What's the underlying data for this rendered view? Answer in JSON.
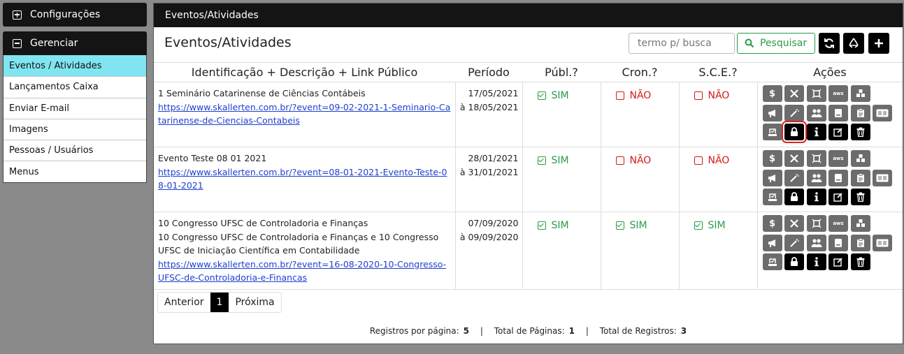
{
  "sidebar": {
    "configuracoes": "Configurações",
    "gerenciar": "Gerenciar",
    "items": [
      {
        "label": "Eventos / Atividades"
      },
      {
        "label": "Lançamentos Caixa"
      },
      {
        "label": "Enviar E-mail"
      },
      {
        "label": "Imagens"
      },
      {
        "label": "Pessoas / Usuários"
      },
      {
        "label": "Menus"
      }
    ]
  },
  "header": {
    "title": "Eventos/Atividades"
  },
  "page": {
    "title": "Eventos/Atividades"
  },
  "search": {
    "placeholder": "termo p/ busca",
    "button": "Pesquisar"
  },
  "toolbar_icons": [
    "refresh-icon",
    "recycle-icon",
    "plus-icon"
  ],
  "columns": [
    "Identificação + Descrição + Link Público",
    "Período",
    "Públ.?",
    "Cron.?",
    "S.C.E.?",
    "Ações"
  ],
  "rows": [
    {
      "lines": [
        "1 Seminário Catarinense de Ciências Contábeis"
      ],
      "link": "https://www.skallerten.com.br/?event=09-02-2021-1-Seminario-Catarinense-de-Ciencias-Contabeis",
      "start": "17/05/2021",
      "end": "à 18/05/2021",
      "publ": "SIM",
      "cron": "NÃO",
      "sce": "NÃO"
    },
    {
      "lines": [
        "Evento Teste 08 01 2021"
      ],
      "link": "https://www.skallerten.com.br/?event=08-01-2021-Evento-Teste-08-01-2021",
      "start": "28/01/2021",
      "end": "à 31/01/2021",
      "publ": "SIM",
      "cron": "NÃO",
      "sce": "NÃO"
    },
    {
      "lines": [
        "10 Congresso UFSC de Controladoria e Finanças",
        "10 Congresso UFSC de Controladoria e Finanças e 10 Congresso UFSC de Iniciação Científica em Contabilidade"
      ],
      "link": "https://www.skallerten.com.br/?event=16-08-2020-10-Congresso-UFSC-de-Controladoria-e-Financas",
      "start": "07/09/2020",
      "end": "à 09/09/2020",
      "publ": "SIM",
      "cron": "SIM",
      "sce": "SIM"
    }
  ],
  "actions_icons": [
    "dollar-icon",
    "tools-icon",
    "frame-icon",
    "aws-icon",
    "boxes-icon",
    "megaphone-icon",
    "magic-wand-icon",
    "users-icon",
    "book-icon",
    "clipboard-icon",
    "id-card-icon",
    "certificate-icon",
    "lock-icon",
    "info-icon",
    "edit-icon",
    "trash-icon"
  ],
  "aws_text": "aws",
  "pagination": {
    "prev": "Anterior",
    "current": "1",
    "next": "Próxima"
  },
  "stats": {
    "per_page_label": "Registros por página:",
    "per_page": "5",
    "pages_label": "Total de Páginas:",
    "pages": "1",
    "total_label": "Total de Registros:",
    "total": "3",
    "sep": "|"
  },
  "colors": {
    "green": "#2a9b47",
    "red": "#d21a1a",
    "active": "#80e5f0",
    "link": "#1d3fd0"
  }
}
